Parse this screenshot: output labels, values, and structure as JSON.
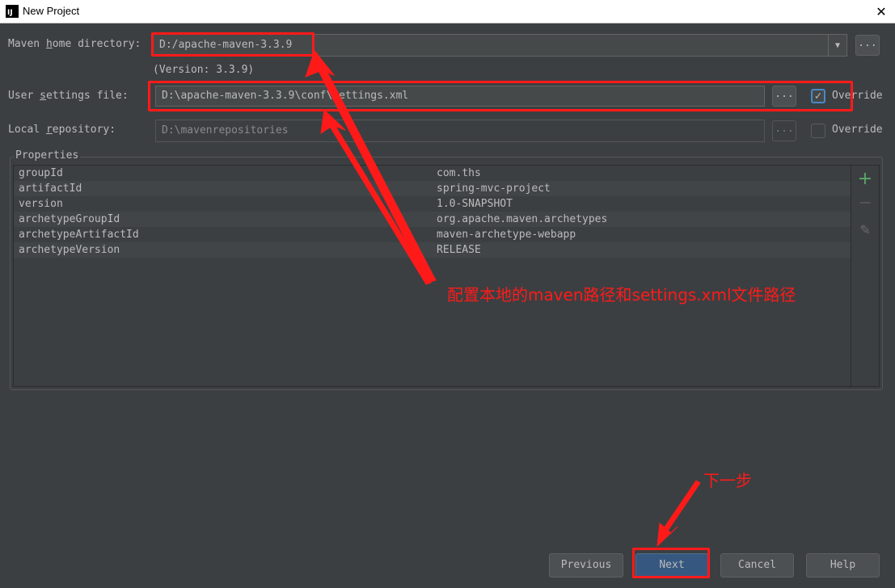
{
  "window": {
    "icon_text": "IJ",
    "title": "New Project",
    "close_glyph": "✕"
  },
  "form": {
    "maven_home": {
      "label_pre": "Maven ",
      "label_u": "h",
      "label_post": "ome directory:",
      "value": "D:/apache-maven-3.3.9",
      "arrow": "▼",
      "browse": "...",
      "version": "(Version: 3.3.9)"
    },
    "user_settings": {
      "label_pre": "User ",
      "label_u": "s",
      "label_post": "ettings file:",
      "value": "D:\\apache-maven-3.3.9\\conf\\settings.xml",
      "browse": "...",
      "override_label": "Override",
      "override_checked": true
    },
    "local_repo": {
      "label_pre": "Local ",
      "label_u": "r",
      "label_post": "epository:",
      "value": "D:\\mavenrepositories",
      "browse": "...",
      "override_label": "Override",
      "override_checked": false
    }
  },
  "properties": {
    "title": "Properties",
    "rows": [
      {
        "key": "groupId",
        "value": "com.ths"
      },
      {
        "key": "artifactId",
        "value": "spring-mvc-project"
      },
      {
        "key": "version",
        "value": "1.0-SNAPSHOT"
      },
      {
        "key": "archetypeGroupId",
        "value": "org.apache.maven.archetypes"
      },
      {
        "key": "archetypeArtifactId",
        "value": "maven-archetype-webapp"
      },
      {
        "key": "archetypeVersion",
        "value": "RELEASE"
      }
    ],
    "toolbar": {
      "add": "+",
      "remove": "—",
      "edit": "✎"
    },
    "colors": {
      "add": "#59a869",
      "disabled": "#6a6a6a"
    }
  },
  "buttons": {
    "previous": "Previous",
    "next": "Next",
    "cancel": "Cancel",
    "help": "Help"
  },
  "annotations": {
    "paths_note": "配置本地的maven路径和settings.xml文件路径",
    "next_note": "下一步",
    "color": "#ff1a1a"
  }
}
